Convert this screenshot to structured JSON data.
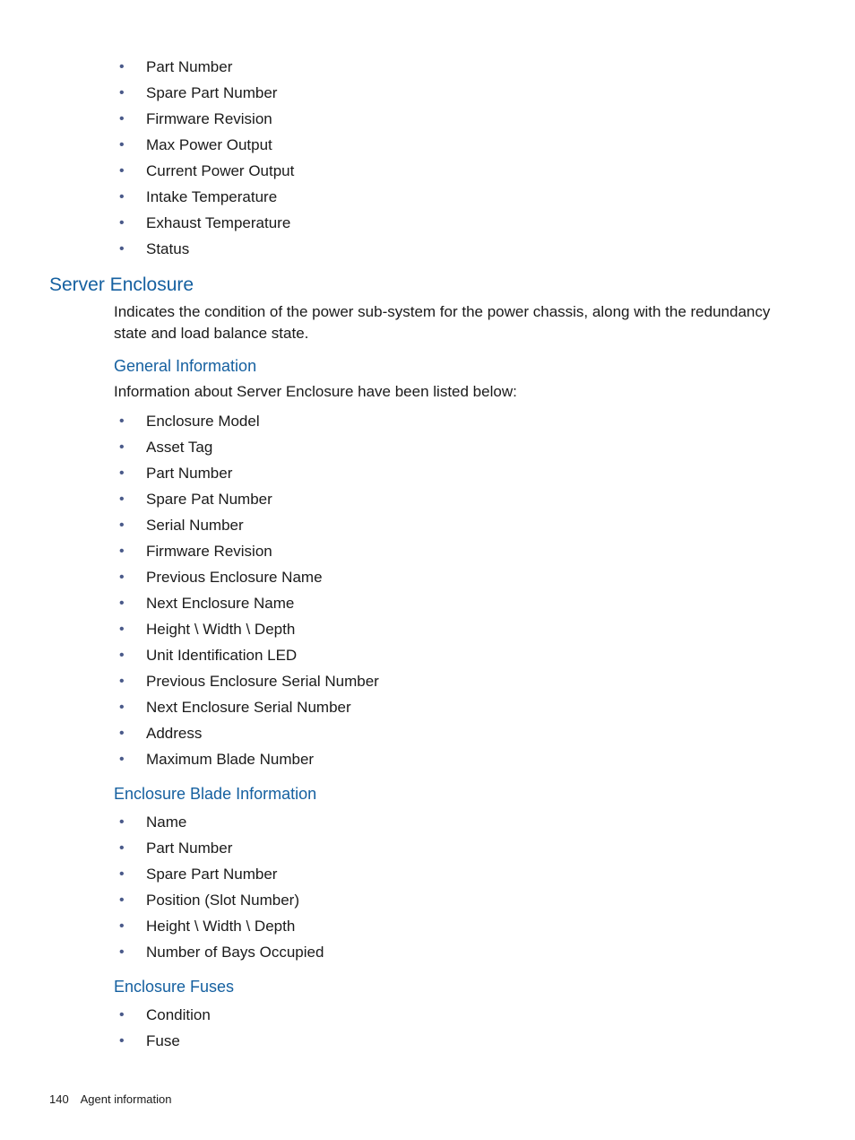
{
  "topList": [
    "Part Number",
    "Spare Part Number",
    "Firmware Revision",
    "Max Power Output",
    "Current Power Output",
    "Intake Temperature",
    "Exhaust Temperature",
    "Status"
  ],
  "section": {
    "title": "Server Enclosure",
    "intro": "Indicates the condition of the power sub-system for the power chassis, along with the redundancy state and load balance state.",
    "sub1": {
      "title": "General Information",
      "lead": "Information about Server Enclosure have been listed below:",
      "items": [
        "Enclosure Model",
        "Asset Tag",
        "Part Number",
        "Spare Pat Number",
        "Serial Number",
        "Firmware Revision",
        "Previous Enclosure Name",
        "Next Enclosure Name",
        "Height \\ Width \\ Depth",
        "Unit Identification LED",
        "Previous Enclosure Serial Number",
        "Next Enclosure Serial Number",
        "Address",
        "Maximum Blade Number"
      ]
    },
    "sub2": {
      "title": "Enclosure Blade Information",
      "items": [
        "Name",
        "Part Number",
        "Spare Part Number",
        "Position (Slot Number)",
        "Height \\ Width \\ Depth",
        "Number of Bays Occupied"
      ]
    },
    "sub3": {
      "title": "Enclosure Fuses",
      "items": [
        "Condition",
        "Fuse"
      ]
    }
  },
  "footer": {
    "pageNumber": "140",
    "label": "Agent information"
  }
}
